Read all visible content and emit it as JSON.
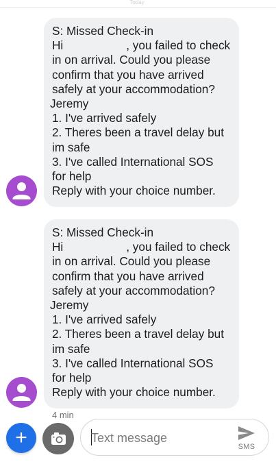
{
  "header": {
    "faint_text": "Today"
  },
  "messages": [
    {
      "lines": [
        "S: Missed Check-in",
        "Hi",
        ", you failed to check",
        "in on arrival. Could you please",
        "confirm that you have arrived",
        "safely at your accommodation?",
        "Jeremy",
        "1. I've arrived safely",
        "2. Theres been a travel delay but",
        "im safe",
        "3. I've called International SOS",
        "for help",
        "Reply with your choice number."
      ]
    },
    {
      "lines": [
        "S: Missed Check-in",
        "Hi",
        ", you failed to check",
        "in on arrival. Could you please",
        "confirm that you have arrived",
        "safely at your accommodation?",
        "Jeremy",
        "1. I've arrived safely",
        "2. Theres been a travel delay but",
        "im safe",
        "3. I've called International SOS",
        "for help",
        "Reply with your choice number."
      ]
    }
  ],
  "timestamp": "4 min",
  "composer": {
    "add_label": "+",
    "placeholder": "Text message",
    "send_label": "SMS"
  },
  "colors": {
    "avatar": "#a64ccf",
    "bubble": "#eff0f2",
    "fab": "#1f6fe6",
    "camera": "#6a6a6a"
  },
  "icons": {
    "avatar": "person-icon",
    "fab": "plus-icon",
    "camera": "camera-icon",
    "send": "send-icon"
  }
}
